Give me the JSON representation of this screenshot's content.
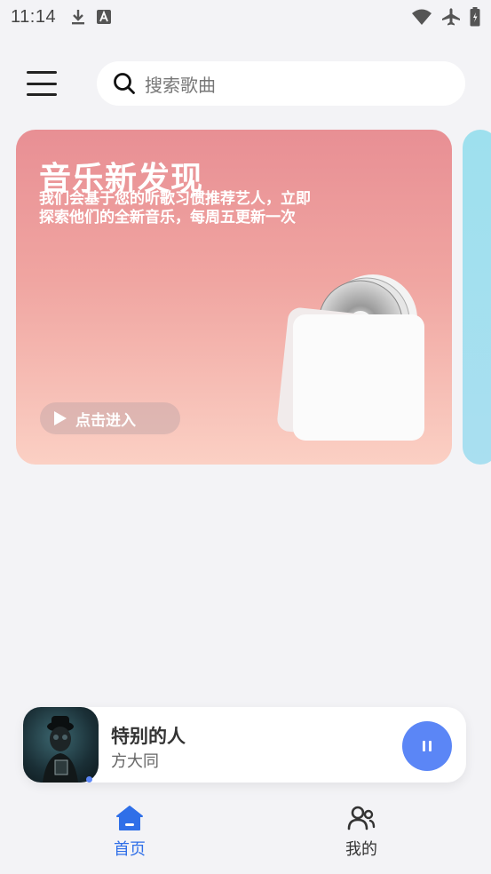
{
  "status_bar": {
    "time": "11:14",
    "icons": [
      "download-icon",
      "text-a-icon",
      "wifi-icon",
      "airplane-icon",
      "battery-icon"
    ]
  },
  "header": {
    "menu_icon": "hamburger-menu-icon",
    "search": {
      "icon": "search-icon",
      "placeholder": "搜索歌曲"
    }
  },
  "banner": {
    "title": "音乐新发现",
    "description": "我们会基于您的听歌习惯推荐艺人，立即探索他们的全新音乐，每周五更新一次",
    "enter_label": "点击进入",
    "gradient_colors": [
      "#e88f94",
      "#fbd0c4"
    ],
    "next_banner_color": "#9ee0ee"
  },
  "mini_player": {
    "song_title": "特别的人",
    "artist": "方大同",
    "state": "playing",
    "accent": "#5b86f6"
  },
  "bottom_nav": {
    "items": [
      {
        "label": "首页",
        "icon": "home-icon",
        "active": true
      },
      {
        "label": "我的",
        "icon": "users-icon",
        "active": false
      }
    ],
    "active_color": "#2f6fe8"
  }
}
